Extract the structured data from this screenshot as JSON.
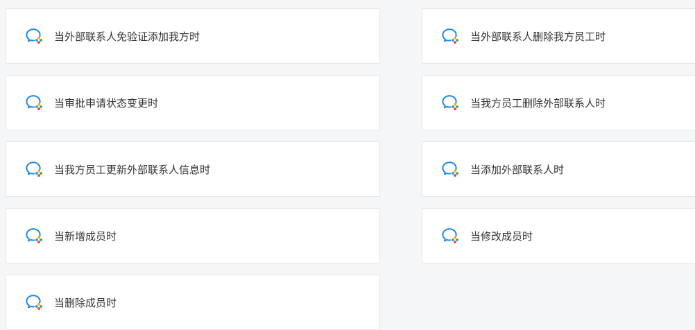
{
  "theme": {
    "background": "#f5f6f7",
    "card_background": "#ffffff",
    "card_border": "#e3e5e8",
    "text": "#333333",
    "icon_primary": "#1e88e5",
    "icon_accents": [
      "#f4b400",
      "#34a853",
      "#ea4335",
      "#4285f4"
    ]
  },
  "triggers": {
    "left": [
      {
        "label": "当外部联系人免验证添加我方时",
        "icon": "wecom-chat-icon"
      },
      {
        "label": "当审批申请状态变更时",
        "icon": "wecom-chat-icon"
      },
      {
        "label": "当我方员工更新外部联系人信息时",
        "icon": "wecom-chat-icon"
      },
      {
        "label": "当新增成员时",
        "icon": "wecom-chat-icon"
      },
      {
        "label": "当删除成员时",
        "icon": "wecom-chat-icon"
      }
    ],
    "right": [
      {
        "label": "当外部联系人删除我方员工时",
        "icon": "wecom-chat-icon"
      },
      {
        "label": "当我方员工删除外部联系人时",
        "icon": "wecom-chat-icon"
      },
      {
        "label": "当添加外部联系人时",
        "icon": "wecom-chat-icon"
      },
      {
        "label": "当修改成员时",
        "icon": "wecom-chat-icon"
      }
    ]
  }
}
